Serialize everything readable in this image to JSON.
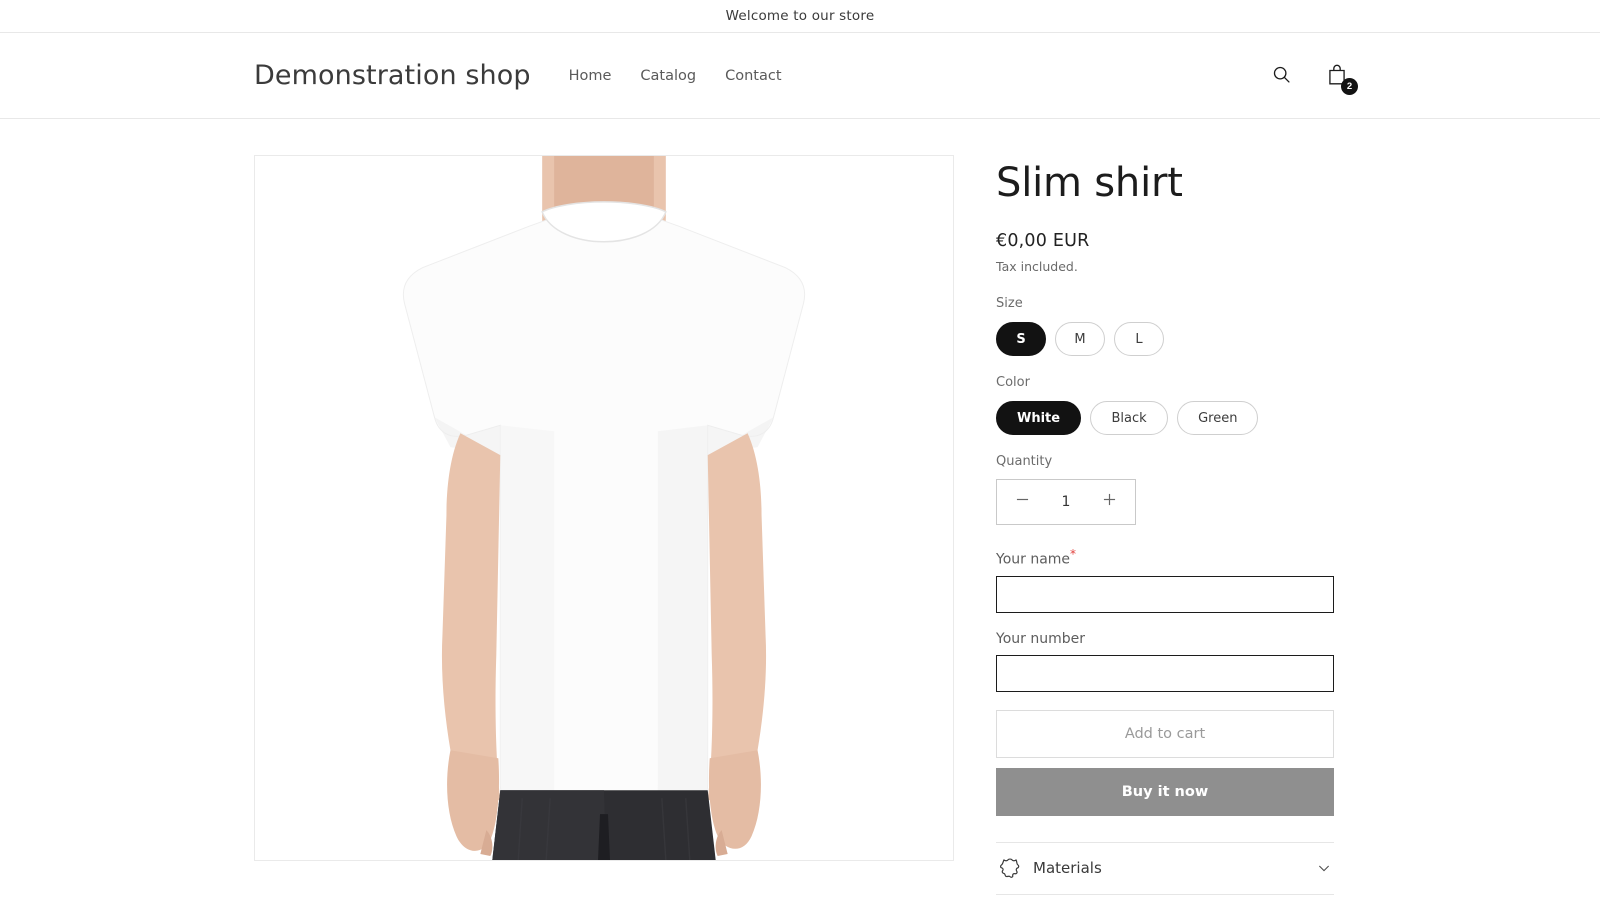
{
  "announcement": {
    "text": "Welcome to our store"
  },
  "header": {
    "brand": "Demonstration shop",
    "nav": [
      {
        "label": "Home"
      },
      {
        "label": "Catalog"
      },
      {
        "label": "Contact"
      }
    ],
    "search_icon": "search-icon",
    "cart_icon": "cart-icon",
    "cart_count": "2"
  },
  "product": {
    "title": "Slim shirt",
    "price": "€0,00 EUR",
    "tax_note": "Tax included.",
    "image_alt": "White t-shirt on model",
    "size": {
      "label": "Size",
      "options": [
        {
          "label": "S",
          "selected": true
        },
        {
          "label": "M",
          "selected": false
        },
        {
          "label": "L",
          "selected": false
        }
      ]
    },
    "color": {
      "label": "Color",
      "options": [
        {
          "label": "White",
          "selected": true
        },
        {
          "label": "Black",
          "selected": false
        },
        {
          "label": "Green",
          "selected": false
        }
      ]
    },
    "quantity": {
      "label": "Quantity",
      "value": "1",
      "decrease_icon": "minus-icon",
      "increase_icon": "plus-icon"
    },
    "fields": [
      {
        "label": "Your name",
        "required": "*",
        "value": "",
        "placeholder": ""
      },
      {
        "label": "Your number",
        "required": "",
        "value": "",
        "placeholder": ""
      }
    ],
    "add_to_cart_label": "Add to cart",
    "buy_now_label": "Buy it now",
    "accordion": {
      "title": "Materials",
      "icon": "leather-hide-icon",
      "chevron": "chevron-down-icon"
    }
  },
  "colors": {
    "selected_pill": "#121212",
    "buy_now_bg": "#8f8f8f",
    "required_star": "#e2433f",
    "border": "#e8e8e8"
  }
}
